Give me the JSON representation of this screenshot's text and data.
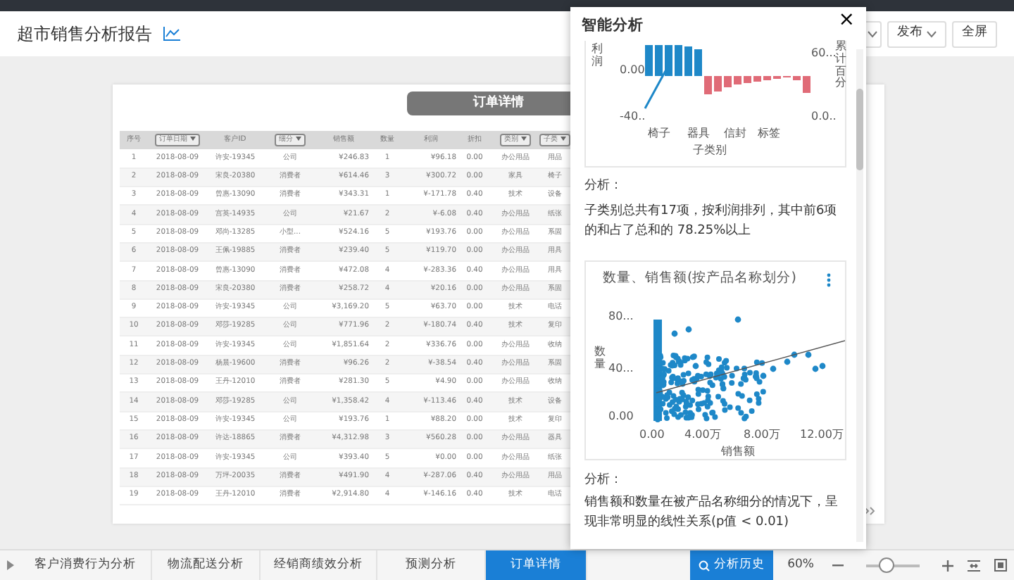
{
  "header": {
    "title": "超市销售分析报告",
    "buttons": [
      {
        "kind": "dropdown"
      },
      {
        "label": "发布",
        "kind": "dropdown"
      },
      {
        "label": "全屏",
        "kind": "plain"
      }
    ]
  },
  "report": {
    "title": "订单详情",
    "table": {
      "columns": [
        {
          "label": "序号",
          "filter": false
        },
        {
          "label": "订单日期",
          "filter": true
        },
        {
          "label": "客户ID",
          "filter": false
        },
        {
          "label": "细分",
          "filter": true
        },
        {
          "label": "销售额",
          "filter": false
        },
        {
          "label": "数量",
          "filter": false
        },
        {
          "label": "利润",
          "filter": false
        },
        {
          "label": "折扣",
          "filter": false
        },
        {
          "label": "类别",
          "filter": true
        },
        {
          "label": "子类",
          "filter": true
        }
      ],
      "rows": [
        [
          "1",
          "2018-08-09",
          "许安-19345",
          "公司",
          "¥246.83",
          "1",
          "¥96.18",
          "0.00",
          "办公用品",
          "用品"
        ],
        [
          "2",
          "2018-08-09",
          "宋良-20380",
          "消费者",
          "¥614.46",
          "3",
          "¥300.72",
          "0.00",
          "家具",
          "椅子"
        ],
        [
          "3",
          "2018-08-09",
          "曾惠-13090",
          "消费者",
          "¥343.31",
          "1",
          "¥-171.78",
          "0.40",
          "技术",
          "设备"
        ],
        [
          "4",
          "2018-08-09",
          "宫英-14935",
          "公司",
          "¥21.67",
          "2",
          "¥-6.08",
          "0.40",
          "办公用品",
          "纸张"
        ],
        [
          "5",
          "2018-08-09",
          "邓尚-13285",
          "小型...",
          "¥524.16",
          "5",
          "¥193.76",
          "0.00",
          "办公用品",
          "系固"
        ],
        [
          "6",
          "2018-08-09",
          "王佩-19885",
          "消费者",
          "¥239.40",
          "5",
          "¥119.70",
          "0.00",
          "办公用品",
          "用具"
        ],
        [
          "7",
          "2018-08-09",
          "曾惠-13090",
          "消费者",
          "¥472.08",
          "4",
          "¥-283.36",
          "0.40",
          "办公用品",
          "用具"
        ],
        [
          "8",
          "2018-08-09",
          "宋良-20380",
          "消费者",
          "¥258.72",
          "4",
          "¥20.16",
          "0.00",
          "办公用品",
          "系固"
        ],
        [
          "9",
          "2018-08-09",
          "许安-19345",
          "公司",
          "¥3,169.20",
          "5",
          "¥63.70",
          "0.00",
          "技术",
          "电话"
        ],
        [
          "10",
          "2018-08-09",
          "邓莎-19285",
          "公司",
          "¥771.96",
          "2",
          "¥-180.74",
          "0.40",
          "技术",
          "复印"
        ],
        [
          "11",
          "2018-08-09",
          "许安-19345",
          "公司",
          "¥1,851.64",
          "2",
          "¥336.76",
          "0.00",
          "办公用品",
          "收纳"
        ],
        [
          "12",
          "2018-08-09",
          "杨晨-19600",
          "消费者",
          "¥96.26",
          "2",
          "¥-38.54",
          "0.40",
          "办公用品",
          "系固"
        ],
        [
          "13",
          "2018-08-09",
          "王丹-12010",
          "消费者",
          "¥281.30",
          "5",
          "¥4.90",
          "0.00",
          "办公用品",
          "收纳"
        ],
        [
          "14",
          "2018-08-09",
          "邓莎-19285",
          "公司",
          "¥1,358.42",
          "4",
          "¥-113.46",
          "0.40",
          "技术",
          "设备"
        ],
        [
          "15",
          "2018-08-09",
          "许安-19345",
          "公司",
          "¥193.76",
          "1",
          "¥88.20",
          "0.00",
          "技术",
          "复印"
        ],
        [
          "16",
          "2018-08-09",
          "许达-18865",
          "消费者",
          "¥4,312.98",
          "3",
          "¥560.28",
          "0.00",
          "办公用品",
          "器具"
        ],
        [
          "17",
          "2018-08-09",
          "许安-19345",
          "公司",
          "¥393.40",
          "5",
          "¥0.00",
          "0.00",
          "办公用品",
          "纸张"
        ],
        [
          "18",
          "2018-08-09",
          "万坪-20035",
          "消费者",
          "¥491.90",
          "4",
          "¥-287.06",
          "0.40",
          "办公用品",
          "用品"
        ],
        [
          "19",
          "2018-08-09",
          "王丹-12010",
          "消费者",
          "¥2,914.80",
          "4",
          "¥-146.16",
          "0.40",
          "技术",
          "电话"
        ]
      ]
    }
  },
  "panel": {
    "title": "智能分析",
    "close": "×",
    "pareto": {
      "ylabel": "利润",
      "yticks": [
        "0.00",
        "-40.."
      ],
      "y2ticks": [
        "60...",
        "0.0.."
      ],
      "y2label": "累计百分",
      "categories": [
        "椅子",
        "器具",
        "信封",
        "标签"
      ],
      "xlabel": "子类别"
    },
    "analysis_1": {
      "heading": "分析：",
      "text": "子类别总共有17项，按利润排列，其中前6项的和占了总和的 78.25%以上"
    },
    "scatter": {
      "title": "数量、销售额(按产品名称划分)",
      "ylabel": "数量",
      "yticks": [
        "80...",
        "40...",
        "0.00"
      ],
      "xticks": [
        "0.00",
        "4.00万",
        "8.00万",
        "12.00万"
      ],
      "xlabel": "销售额"
    },
    "analysis_2": {
      "heading": "分析：",
      "text": "销售额和数量在被产品名称细分的情况下，呈现非常明显的线性关系(p值 < 0.01)"
    }
  },
  "tabs": [
    {
      "label": "客户消费行为分析",
      "selected": false
    },
    {
      "label": "物流配送分析",
      "selected": false
    },
    {
      "label": "经销商绩效分析",
      "selected": false
    },
    {
      "label": "预测分析",
      "selected": false
    },
    {
      "label": "订单详情",
      "selected": true
    }
  ],
  "history_button": "分析历史",
  "zoom": {
    "label": "60%",
    "level": 0.38
  }
}
